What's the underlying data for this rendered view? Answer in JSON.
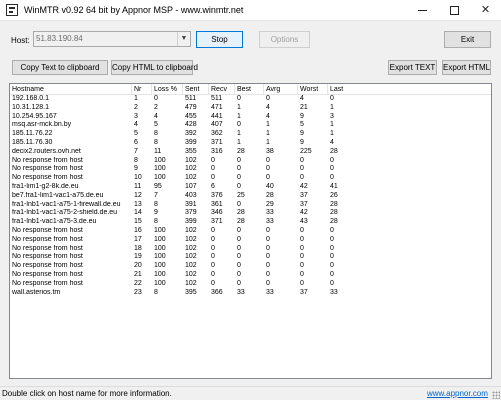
{
  "window": {
    "title": "WinMTR v0.92 64 bit by Appnor MSP - www.winmtr.net",
    "icon": "winmtr-app-icon",
    "controls": {
      "minimize": "minimize-icon",
      "maximize": "maximize-icon",
      "close": "✕"
    }
  },
  "toolbar": {
    "host_label": "Host:",
    "host_value": "51.83.190.84",
    "combo_arrow": "▼",
    "stop_label": "Stop",
    "options_label": "Options",
    "exit_label": "Exit",
    "copy_text_label": "Copy Text to clipboard",
    "copy_html_label": "Copy HTML to clipboard",
    "export_text_label": "Export TEXT",
    "export_html_label": "Export HTML"
  },
  "table": {
    "columns": [
      "Hostname",
      "Nr",
      "Loss %",
      "Sent",
      "Recv",
      "Best",
      "Avrg",
      "Worst",
      "Last"
    ],
    "rows": [
      [
        "192.168.0.1",
        "1",
        "0",
        "511",
        "511",
        "0",
        "0",
        "4",
        "0"
      ],
      [
        "10.31.128.1",
        "2",
        "2",
        "479",
        "471",
        "1",
        "4",
        "21",
        "1"
      ],
      [
        "10.254.95.167",
        "3",
        "4",
        "455",
        "441",
        "1",
        "4",
        "9",
        "3"
      ],
      [
        "msq.asr-mck.bn.by",
        "4",
        "5",
        "428",
        "407",
        "0",
        "1",
        "5",
        "1"
      ],
      [
        "185.11.76.22",
        "5",
        "8",
        "392",
        "362",
        "1",
        "1",
        "9",
        "1"
      ],
      [
        "185.11.76.30",
        "6",
        "8",
        "399",
        "371",
        "1",
        "1",
        "9",
        "4"
      ],
      [
        "decix2.routers.ovh.net",
        "7",
        "11",
        "355",
        "316",
        "28",
        "38",
        "225",
        "28"
      ],
      [
        "No response from host",
        "8",
        "100",
        "102",
        "0",
        "0",
        "0",
        "0",
        "0"
      ],
      [
        "No response from host",
        "9",
        "100",
        "102",
        "0",
        "0",
        "0",
        "0",
        "0"
      ],
      [
        "No response from host",
        "10",
        "100",
        "102",
        "0",
        "0",
        "0",
        "0",
        "0"
      ],
      [
        "fra1-lim1-g2-8k.de.eu",
        "11",
        "95",
        "107",
        "6",
        "0",
        "40",
        "42",
        "41"
      ],
      [
        "be7.fra1-lim1-vac1-a75.de.eu",
        "12",
        "7",
        "403",
        "376",
        "25",
        "28",
        "37",
        "26"
      ],
      [
        "fra1-lnb1-vac1-a75-1-firewall.de.eu",
        "13",
        "8",
        "391",
        "361",
        "0",
        "29",
        "37",
        "28"
      ],
      [
        "fra1-lnb1-vac1-a75-2-shield.de.eu",
        "14",
        "9",
        "379",
        "346",
        "28",
        "33",
        "42",
        "28"
      ],
      [
        "fra1-lnb1-vac1-a75-3.de.eu",
        "15",
        "8",
        "399",
        "371",
        "28",
        "33",
        "43",
        "28"
      ],
      [
        "No response from host",
        "16",
        "100",
        "102",
        "0",
        "0",
        "0",
        "0",
        "0"
      ],
      [
        "No response from host",
        "17",
        "100",
        "102",
        "0",
        "0",
        "0",
        "0",
        "0"
      ],
      [
        "No response from host",
        "18",
        "100",
        "102",
        "0",
        "0",
        "0",
        "0",
        "0"
      ],
      [
        "No response from host",
        "19",
        "100",
        "102",
        "0",
        "0",
        "0",
        "0",
        "0"
      ],
      [
        "No response from host",
        "20",
        "100",
        "102",
        "0",
        "0",
        "0",
        "0",
        "0"
      ],
      [
        "No response from host",
        "21",
        "100",
        "102",
        "0",
        "0",
        "0",
        "0",
        "0"
      ],
      [
        "No response from host",
        "22",
        "100",
        "102",
        "0",
        "0",
        "0",
        "0",
        "0"
      ],
      [
        "wall.asterios.tm",
        "23",
        "8",
        "395",
        "366",
        "33",
        "33",
        "37",
        "33"
      ]
    ]
  },
  "statusbar": {
    "text": "Double click on host name for more information.",
    "link": "www.appnor.com"
  }
}
